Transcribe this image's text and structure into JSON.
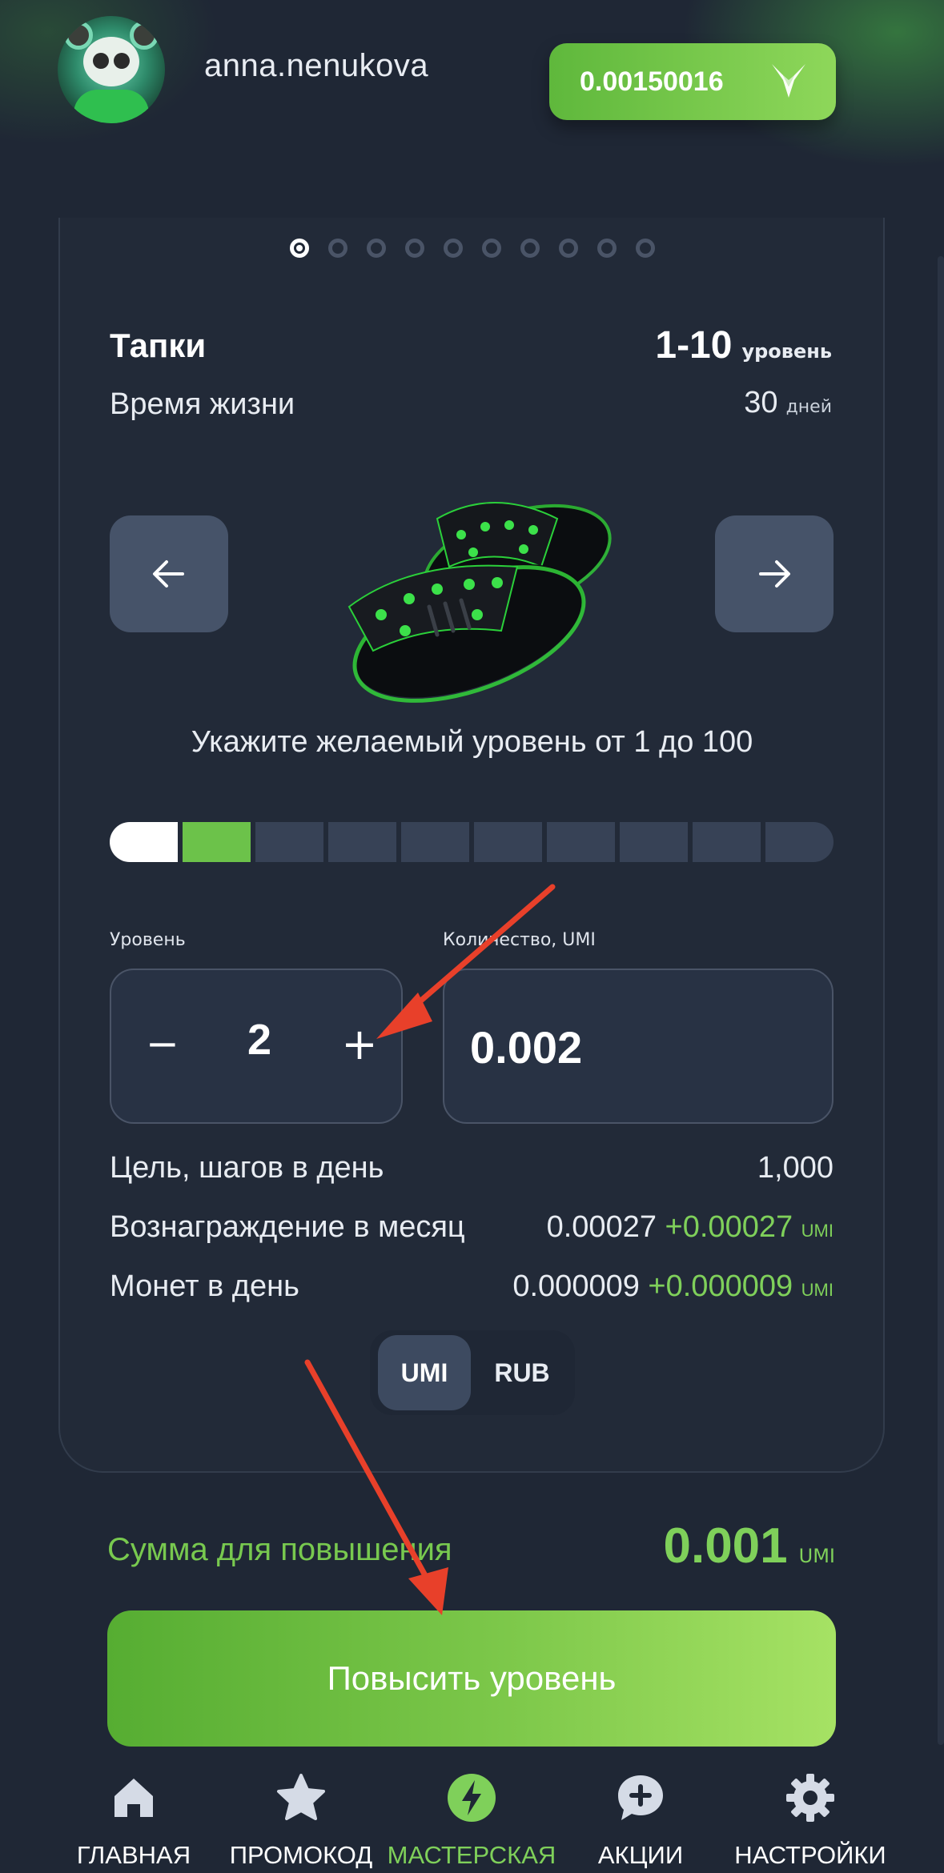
{
  "header": {
    "username": "anna.nenukova",
    "balance": "0.00150016",
    "balance_icon": "fox-logo-icon"
  },
  "carousel": {
    "total_slides": 10,
    "active_index": 0
  },
  "item": {
    "title": "Тапки",
    "level_range": "1-10",
    "level_unit": "уровень",
    "lifetime_label": "Время жизни",
    "lifetime_value": "30",
    "lifetime_unit": "дней"
  },
  "hint": "Укажите желаемый уровень от 1 до 100",
  "level_bar": {
    "segments": 10,
    "filled_white": 1,
    "filled_green": 1
  },
  "inputs": {
    "level_label": "Уровень",
    "level_value": "2",
    "minus": "−",
    "plus": "+",
    "quantity_label": "Количество, UMI",
    "quantity_value": "0.002"
  },
  "stats": {
    "goal_label": "Цель, шагов в день",
    "goal_value": "1,000",
    "reward_label": "Вознаграждение в месяц",
    "reward_value": "0.00027",
    "reward_bonus": "+0.00027",
    "reward_unit": "UMI",
    "coins_label": "Монет в день",
    "coins_value": "0.000009",
    "coins_bonus": "+0.000009",
    "coins_unit": "UMI"
  },
  "currency_toggle": {
    "selected": "UMI",
    "options": [
      "UMI",
      "RUB"
    ]
  },
  "summary": {
    "label": "Сумма для повышения",
    "value": "0.001",
    "unit": "UMI"
  },
  "upgrade_button": "Повысить уровень",
  "bottom_nav": [
    {
      "label": "ГЛАВНАЯ",
      "icon": "home-icon"
    },
    {
      "label": "ПРОМОКОД",
      "icon": "star-icon"
    },
    {
      "label": "МАСТЕРСКАЯ",
      "icon": "bolt-icon",
      "active": true
    },
    {
      "label": "АКЦИИ",
      "icon": "chat-plus-icon"
    },
    {
      "label": "НАСТРОЙКИ",
      "icon": "gear-icon"
    }
  ],
  "colors": {
    "accent": "#7fd05a",
    "background": "#1f2735",
    "card": "#222a38",
    "annotation": "#e8402a"
  }
}
